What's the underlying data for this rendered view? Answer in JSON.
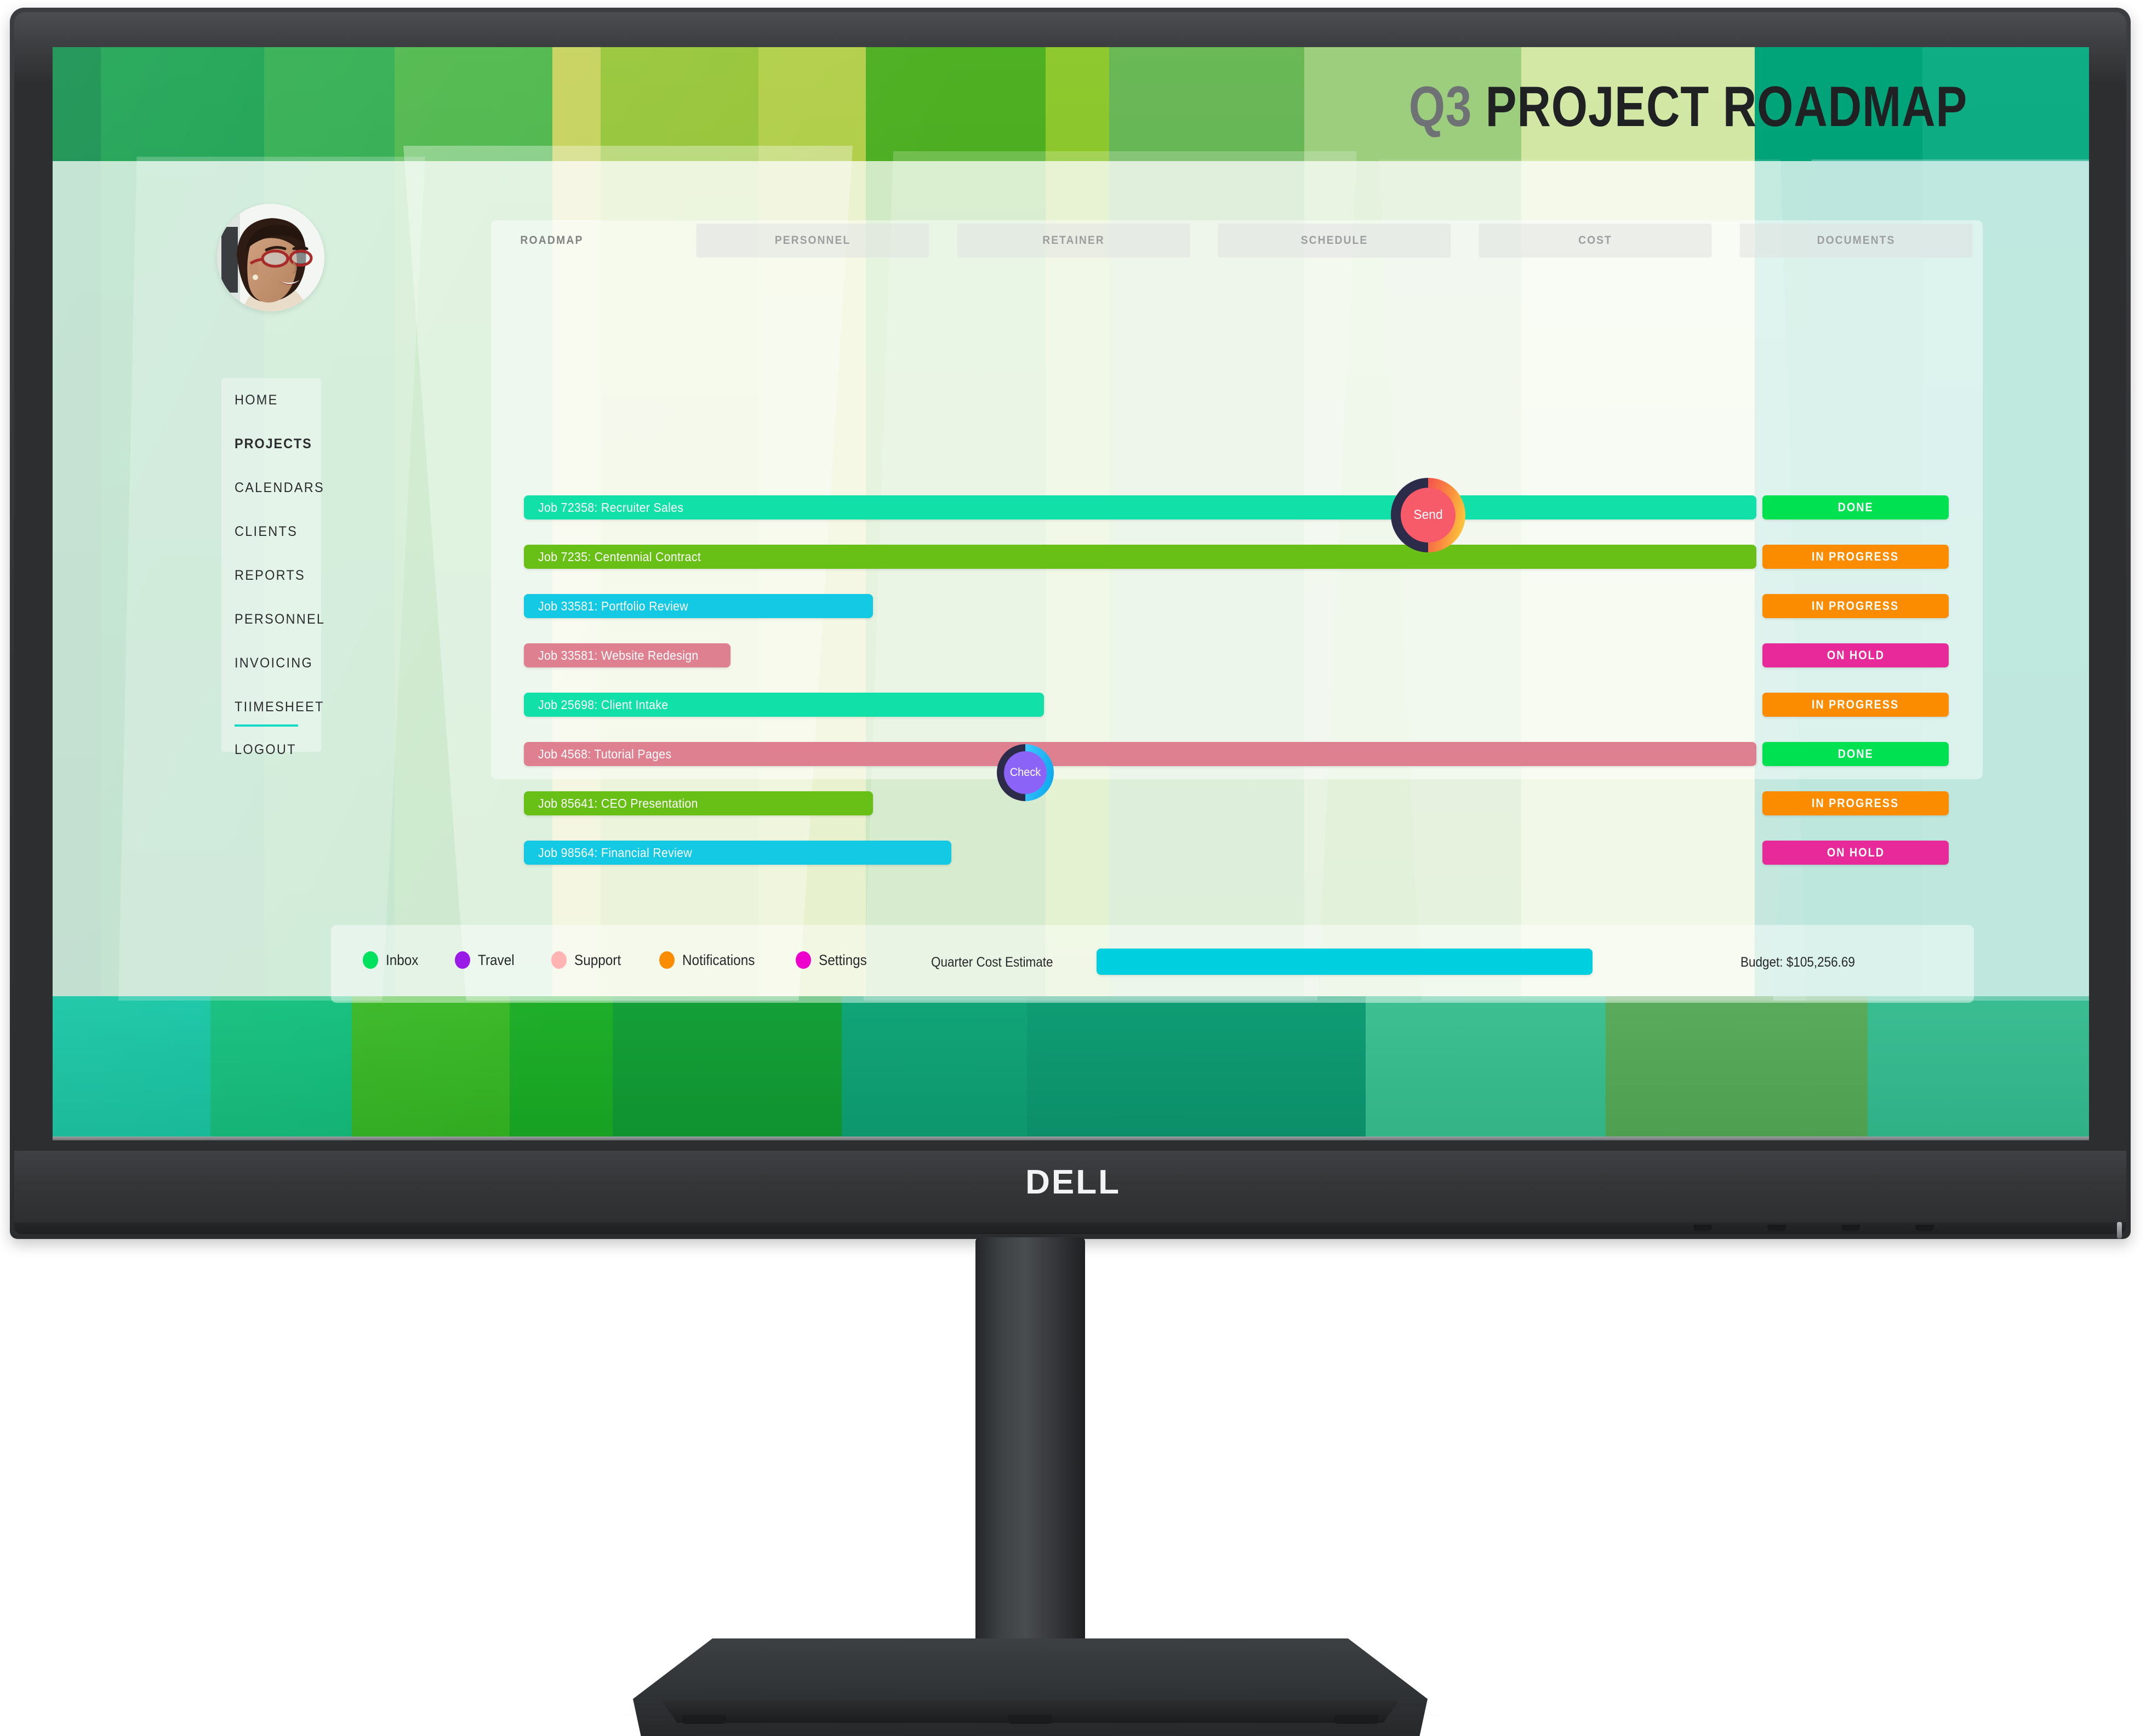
{
  "device": {
    "brand": "DELL"
  },
  "header": {
    "title_prefix": "Q3",
    "title_main": "PROJECT ROADMAP"
  },
  "avatar": {
    "alt": "user-profile-photo"
  },
  "tabs": [
    {
      "label": "ROADMAP",
      "active": true
    },
    {
      "label": "PERSONNEL",
      "active": false
    },
    {
      "label": "RETAINER",
      "active": false
    },
    {
      "label": "SCHEDULE",
      "active": false
    },
    {
      "label": "COST",
      "active": false
    },
    {
      "label": "DOCUMENTS",
      "active": false
    }
  ],
  "sidebar": {
    "items": [
      {
        "label": "HOME",
        "active": false
      },
      {
        "label": "PROJECTS",
        "active": true
      },
      {
        "label": "CALENDARS",
        "active": false
      },
      {
        "label": "CLIENTS",
        "active": false
      },
      {
        "label": "REPORTS",
        "active": false
      },
      {
        "label": "PERSONNEL",
        "active": false
      },
      {
        "label": "INVOICING",
        "active": false
      },
      {
        "label": "TIIMESHEET",
        "active": false
      },
      {
        "label": "LOGOUT",
        "active": false
      }
    ],
    "divider_color": "#16d9c6"
  },
  "chart_data": {
    "type": "bar",
    "title": "Q3 PROJECT ROADMAP",
    "xlabel": "",
    "ylabel": "",
    "orientation": "horizontal",
    "note": "Gantt-style roadmap: bar length = relative job duration (% of track width)",
    "categories": [
      "Job 72358: Recruiter Sales",
      "Job 7235: Centennial Contract",
      "Job 33581: Portfolio Review",
      "Job 33581: Website Redesign",
      "Job 25698: Client Intake",
      "Job 4568: Tutorial Pages",
      "Job 85641: CEO Presentation",
      "Job 98564: Financial Review"
    ],
    "values": [
      86.5,
      86.5,
      24.5,
      14.5,
      36.5,
      86.5,
      24.5,
      30.0
    ],
    "statuses": [
      "DONE",
      "IN PROGRESS",
      "IN PROGRESS",
      "ON HOLD",
      "IN PROGRESS",
      "DONE",
      "IN PROGRESS",
      "ON HOLD"
    ],
    "bar_colors": [
      "#11e0a8",
      "#68c017",
      "#14c9e4",
      "#de8090",
      "#11e0a8",
      "#de8090",
      "#68c017",
      "#14c9e4"
    ],
    "status_colors": {
      "DONE": "#00e152",
      "IN PROGRESS": "#fb8c00",
      "ON HOLD": "#e8299a"
    },
    "xlim": [
      0,
      100
    ],
    "grid": false,
    "legend_position": "bottom"
  },
  "roadmap": {
    "rows": [
      {
        "label": "Job 72358: Recruiter Sales",
        "width_pct": 86.5,
        "color": "#11e0a8",
        "status": "DONE",
        "status_color": "#00e152"
      },
      {
        "label": "Job 7235: Centennial Contract",
        "width_pct": 86.5,
        "color": "#68c017",
        "status": "IN PROGRESS",
        "status_color": "#fb8c00"
      },
      {
        "label": "Job 33581: Portfolio Review",
        "width_pct": 24.5,
        "color": "#14c9e4",
        "status": "IN PROGRESS",
        "status_color": "#fb8c00"
      },
      {
        "label": "Job 33581: Website Redesign",
        "width_pct": 14.5,
        "color": "#de8090",
        "status": "ON HOLD",
        "status_color": "#e8299a"
      },
      {
        "label": "Job 25698: Client Intake",
        "width_pct": 36.5,
        "color": "#11e0a8",
        "status": "IN PROGRESS",
        "status_color": "#fb8c00"
      },
      {
        "label": "Job 4568: Tutorial Pages",
        "width_pct": 86.5,
        "color": "#de8090",
        "status": "DONE",
        "status_color": "#00e152"
      },
      {
        "label": "Job 85641: CEO Presentation",
        "width_pct": 24.5,
        "color": "#68c017",
        "status": "IN PROGRESS",
        "status_color": "#fb8c00"
      },
      {
        "label": "Job 98564: Financial Review",
        "width_pct": 30.0,
        "color": "#14c9e4",
        "status": "ON HOLD",
        "status_color": "#e8299a"
      }
    ]
  },
  "markers": [
    {
      "label": "Send",
      "left_pct": 63.6,
      "row": 0
    },
    {
      "label": "Check",
      "left_pct": 23.5,
      "row": 6
    }
  ],
  "legend": [
    {
      "label": "Inbox",
      "color": "#00e15e"
    },
    {
      "label": "Travel",
      "color": "#9a1ae8"
    },
    {
      "label": "Support",
      "color": "#ffb3b3"
    },
    {
      "label": "Notifications",
      "color": "#fb8c00"
    },
    {
      "label": "Settings",
      "color": "#ee00cc"
    }
  ],
  "cost": {
    "label": "Quarter Cost Estimate",
    "bar_color": "#00cfe0",
    "bar_fill_pct": 100,
    "budget_label": "Budget: $105,256.69"
  }
}
